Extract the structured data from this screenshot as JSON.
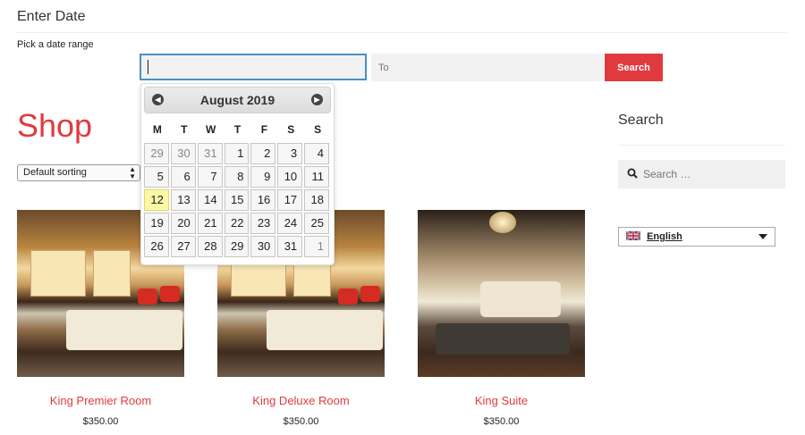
{
  "date_section": {
    "title": "Enter Date",
    "range_label": "Pick a date range",
    "from_value": "",
    "to_placeholder": "To",
    "search_button": "Search"
  },
  "calendar": {
    "month_title": "August 2019",
    "prev_icon": "chevron-left-icon",
    "next_icon": "chevron-right-icon",
    "weekdays": [
      "M",
      "T",
      "W",
      "T",
      "F",
      "S",
      "S"
    ],
    "weeks": [
      [
        {
          "d": "29",
          "other": true
        },
        {
          "d": "30",
          "other": true
        },
        {
          "d": "31",
          "other": true
        },
        {
          "d": "1"
        },
        {
          "d": "2"
        },
        {
          "d": "3"
        },
        {
          "d": "4"
        }
      ],
      [
        {
          "d": "5"
        },
        {
          "d": "6"
        },
        {
          "d": "7"
        },
        {
          "d": "8"
        },
        {
          "d": "9"
        },
        {
          "d": "10"
        },
        {
          "d": "11"
        }
      ],
      [
        {
          "d": "12",
          "today": true
        },
        {
          "d": "13"
        },
        {
          "d": "14"
        },
        {
          "d": "15"
        },
        {
          "d": "16"
        },
        {
          "d": "17"
        },
        {
          "d": "18"
        }
      ],
      [
        {
          "d": "19"
        },
        {
          "d": "20"
        },
        {
          "d": "21"
        },
        {
          "d": "22"
        },
        {
          "d": "23"
        },
        {
          "d": "24"
        },
        {
          "d": "25"
        }
      ],
      [
        {
          "d": "26"
        },
        {
          "d": "27"
        },
        {
          "d": "28"
        },
        {
          "d": "29"
        },
        {
          "d": "30"
        },
        {
          "d": "31"
        },
        {
          "d": "1",
          "other": true
        }
      ]
    ]
  },
  "shop": {
    "title": "Shop",
    "sort_selected": "Default sorting",
    "products": [
      {
        "name": "King Premier Room",
        "price": "$350.00"
      },
      {
        "name": "King Deluxe Room",
        "price": "$350.00"
      },
      {
        "name": "King Suite",
        "price": "$350.00"
      }
    ]
  },
  "sidebar": {
    "search_title": "Search",
    "search_placeholder": "Search …",
    "language": "English"
  },
  "colors": {
    "accent": "#e03a3e",
    "focus_border": "#4a90c9",
    "today_highlight": "#fbf7a7"
  }
}
